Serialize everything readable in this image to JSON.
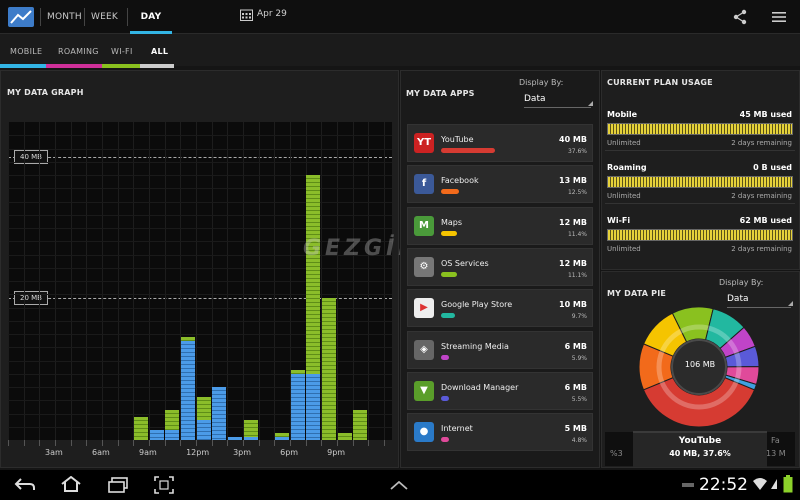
{
  "header": {
    "tabs": [
      {
        "label": "MONTH",
        "active": false
      },
      {
        "label": "WEEK",
        "active": false
      },
      {
        "label": "DAY",
        "active": true
      }
    ],
    "date": "Apr 29"
  },
  "network_tabs": [
    {
      "label": "MOBILE",
      "color": "#33b5e5"
    },
    {
      "label": "ROAMING",
      "color": "#d0309a"
    },
    {
      "label": "WI-FI",
      "color": "#8ac11f"
    },
    {
      "label": "ALL",
      "color": "#cccccc",
      "active": true
    }
  ],
  "graph": {
    "title": "MY DATA GRAPH",
    "ref_lines": [
      "40 MB",
      "20 MB"
    ],
    "watermark": "GEZGİNLER"
  },
  "chart_data": {
    "type": "bar",
    "stacked": true,
    "unit": "MB",
    "x_tick_labels": [
      "3am",
      "6am",
      "9am",
      "12pm",
      "3pm",
      "6pm",
      "9pm"
    ],
    "reference_lines": [
      40,
      20
    ],
    "ylim": [
      0,
      48
    ],
    "series": [
      {
        "name": "Mobile",
        "color": "#4b9be8",
        "values": [
          0,
          0,
          0,
          0,
          0,
          0,
          0,
          0,
          0,
          1.5,
          1.5,
          15,
          3,
          8,
          0.5,
          0.5,
          0,
          0.5,
          10,
          10,
          0,
          0,
          0
        ]
      },
      {
        "name": "Wi-Fi",
        "color": "#8bbd2a",
        "values": [
          0,
          0,
          0,
          0,
          0,
          0,
          0,
          0,
          3.5,
          0,
          3,
          0.5,
          3.5,
          0,
          0,
          2.5,
          0,
          0.5,
          0.5,
          30,
          21.5,
          1,
          4.5
        ]
      }
    ]
  },
  "apps": {
    "title": "MY DATA APPS",
    "display_by_label": "Display By:",
    "display_by_value": "Data",
    "items": [
      {
        "name": "YouTube",
        "mb": "40 MB",
        "pct": "37.6%",
        "color": "#d63b32",
        "fraction": 0.376
      },
      {
        "name": "Facebook",
        "mb": "13 MB",
        "pct": "12.5%",
        "color": "#f26a1b",
        "fraction": 0.125
      },
      {
        "name": "Maps",
        "mb": "12 MB",
        "pct": "11.4%",
        "color": "#f5c400",
        "fraction": 0.114
      },
      {
        "name": "OS Services",
        "mb": "12 MB",
        "pct": "11.1%",
        "color": "#8ac11f",
        "fraction": 0.111
      },
      {
        "name": "Google Play Store",
        "mb": "10 MB",
        "pct": "9.7%",
        "color": "#22b8a0",
        "fraction": 0.097
      },
      {
        "name": "Streaming Media",
        "mb": "6 MB",
        "pct": "5.9%",
        "color": "#c044c8",
        "fraction": 0.059
      },
      {
        "name": "Download Manager",
        "mb": "6 MB",
        "pct": "5.5%",
        "color": "#5a5ad8",
        "fraction": 0.055
      },
      {
        "name": "Internet",
        "mb": "5 MB",
        "pct": "4.8%",
        "color": "#e04a9a",
        "fraction": 0.048
      }
    ]
  },
  "plan": {
    "title": "CURRENT PLAN USAGE",
    "items": [
      {
        "name": "Mobile",
        "used": "45 MB used",
        "limit": "Unlimited",
        "remaining": "2 days remaining"
      },
      {
        "name": "Roaming",
        "used": "0 B used",
        "limit": "Unlimited",
        "remaining": "2 days remaining"
      },
      {
        "name": "Wi-Fi",
        "used": "62 MB used",
        "limit": "Unlimited",
        "remaining": "2 days remaining"
      }
    ]
  },
  "pie": {
    "title": "MY DATA PIE",
    "display_by_label": "Display By:",
    "display_by_value": "Data",
    "center": "106 MB",
    "left_pct": "%3",
    "selected_name": "YouTube",
    "selected_value": "40 MB, 37.6%",
    "right_name": "Fa",
    "right_value": "13 M"
  },
  "status": {
    "time": "22:52"
  }
}
